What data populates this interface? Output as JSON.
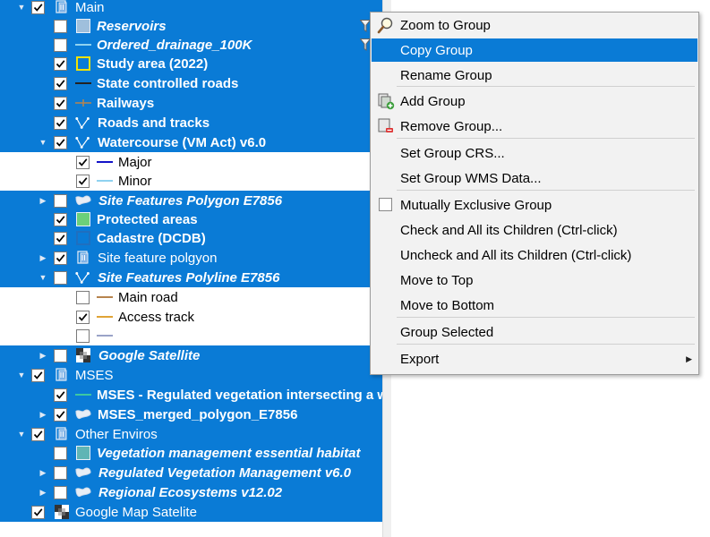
{
  "layers_panel": {
    "rows": [
      {
        "label": "Main",
        "checked": true,
        "expand": "open",
        "style": "normal",
        "icon": "group"
      },
      {
        "label": "Reservoirs",
        "checked": false,
        "style": "bold-italic",
        "icon": "swatch-fill"
      },
      {
        "label": "Ordered_drainage_100K",
        "checked": false,
        "style": "bold-italic",
        "icon": "line-symbol"
      },
      {
        "label": "Study area (2022)",
        "checked": true,
        "style": "bold",
        "icon": "swatch-outline"
      },
      {
        "label": "State controlled roads",
        "checked": true,
        "style": "bold",
        "icon": "line-symbol"
      },
      {
        "label": "Railways",
        "checked": true,
        "style": "bold",
        "icon": "railway-symbol"
      },
      {
        "label": "Roads and tracks",
        "checked": true,
        "style": "bold",
        "icon": "rule-based"
      },
      {
        "label": "Watercourse (VM Act) v6.0",
        "checked": true,
        "expand": "open",
        "style": "bold",
        "icon": "rule-based"
      },
      {
        "label": "Major",
        "checked": true,
        "style": "normal",
        "icon": "line-symbol"
      },
      {
        "label": "Minor",
        "checked": true,
        "style": "normal",
        "icon": "line-symbol"
      },
      {
        "label": "Site Features Polygon E7856",
        "checked": false,
        "expand": "closed",
        "style": "bold-italic",
        "icon": "polygon"
      },
      {
        "label": "Protected areas",
        "checked": true,
        "style": "bold",
        "icon": "swatch-fill"
      },
      {
        "label": "Cadastre (DCDB)",
        "checked": true,
        "style": "bold",
        "icon": "swatch-outline"
      },
      {
        "label": "Site feature polgyon",
        "checked": true,
        "expand": "closed",
        "style": "normal",
        "icon": "group"
      },
      {
        "label": "Site Features Polyline E7856",
        "checked": false,
        "expand": "open",
        "style": "bold-italic",
        "icon": "rule-based"
      },
      {
        "label": "Main road",
        "checked": false,
        "style": "normal",
        "icon": "line-symbol"
      },
      {
        "label": "Access track",
        "checked": true,
        "style": "normal",
        "icon": "line-symbol"
      },
      {
        "label": "",
        "checked": false,
        "style": "normal",
        "icon": "line-symbol"
      },
      {
        "label": "Google Satellite",
        "checked": false,
        "expand": "closed",
        "style": "bold-italic",
        "icon": "raster"
      },
      {
        "label": "MSES",
        "checked": true,
        "expand": "open",
        "style": "normal",
        "icon": "group"
      },
      {
        "label": "MSES - Regulated vegetation intersecting a watercourse",
        "checked": true,
        "style": "bold",
        "icon": "line-symbol"
      },
      {
        "label": "MSES_merged_polygon_E7856",
        "checked": true,
        "expand": "closed",
        "style": "bold",
        "icon": "polygon"
      },
      {
        "label": "Other Enviros",
        "checked": true,
        "expand": "open",
        "style": "normal",
        "icon": "group"
      },
      {
        "label": "Vegetation management essential habitat",
        "checked": false,
        "style": "bold-italic",
        "icon": "swatch-fill"
      },
      {
        "label": "Regulated Vegetation Management v6.0",
        "checked": false,
        "expand": "closed",
        "style": "bold-italic",
        "icon": "polygon"
      },
      {
        "label": "Regional Ecosystems v12.02",
        "checked": false,
        "expand": "closed",
        "style": "bold-italic",
        "icon": "polygon"
      },
      {
        "label": "Google Map Satelite",
        "checked": true,
        "style": "normal",
        "icon": "raster"
      }
    ]
  },
  "context_menu": {
    "items": [
      {
        "label": "Zoom to Group",
        "icon": "zoom-icon"
      },
      {
        "label": "Copy Group",
        "highlighted": true
      },
      {
        "label": "Rename Group"
      },
      {
        "label": "Add Group",
        "icon": "add-group-icon"
      },
      {
        "label": "Remove Group...",
        "icon": "remove-group-icon"
      },
      {
        "label": "Set Group CRS..."
      },
      {
        "label": "Set Group WMS Data..."
      },
      {
        "label": "Mutually Exclusive Group",
        "checkable": true
      },
      {
        "label": "Check and All its Children (Ctrl-click)"
      },
      {
        "label": "Uncheck and All its Children (Ctrl-click)"
      },
      {
        "label": "Move to Top"
      },
      {
        "label": "Move to Bottom"
      },
      {
        "label": "Group Selected"
      },
      {
        "label": "Export",
        "submenu": true
      }
    ]
  },
  "colors": {
    "selection": "#0a7bd6",
    "study_area": "#f2e200",
    "protected": "#6bd07a",
    "reservoir": "#9fbfdc",
    "major": "#1313c8",
    "minor": "#8fd2f0",
    "road": "#b7844e",
    "track": "#e0a436",
    "unnamed": "#9aa3c8",
    "mses": "#3ec7a2",
    "veg_habitat": "#5fb5b5",
    "cadastre": "#1f6fbf"
  }
}
